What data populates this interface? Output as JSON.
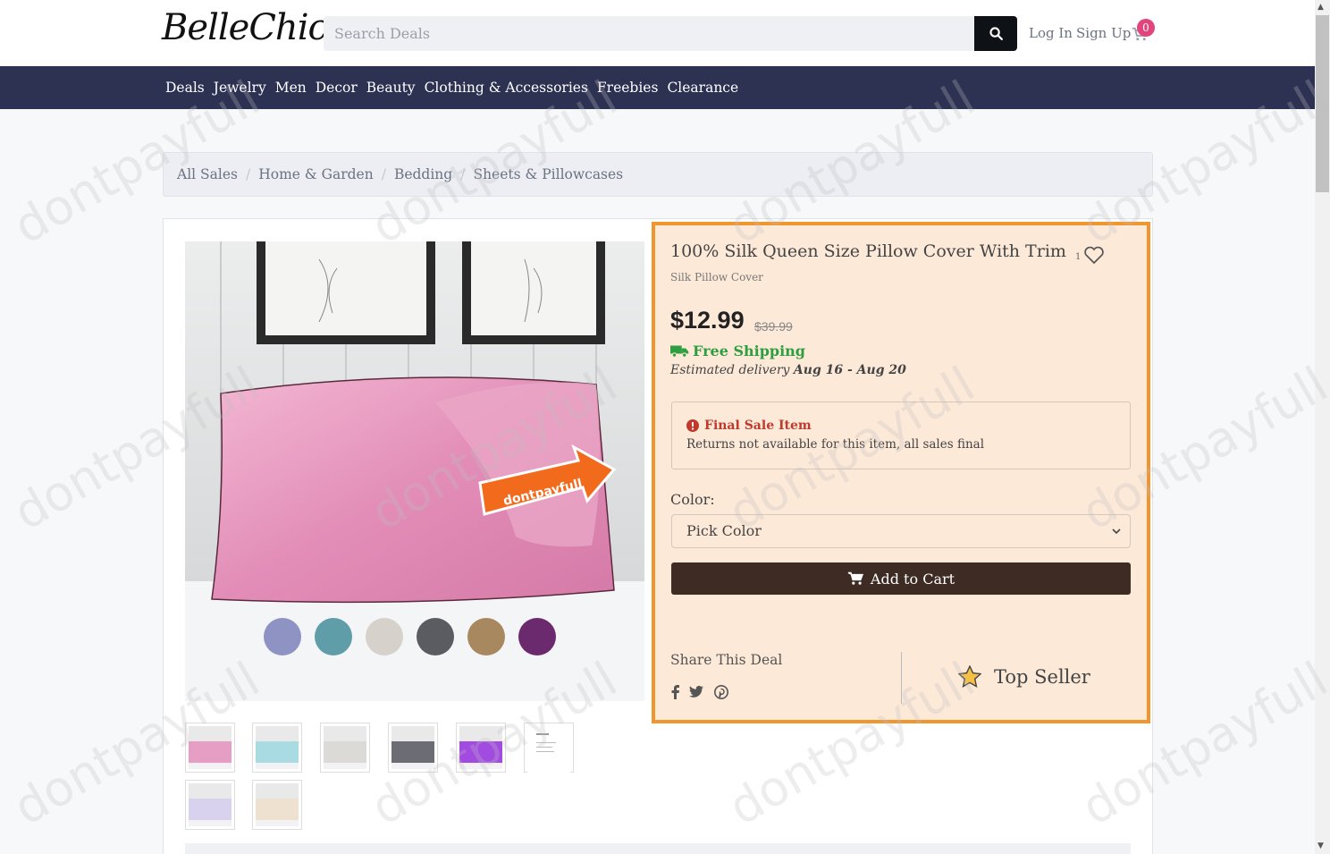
{
  "header": {
    "logo": "BelleChic",
    "search_placeholder": "Search Deals",
    "login": "Log In",
    "signup": "Sign Up",
    "cart_count": "0"
  },
  "categories": [
    "Deals",
    "Jewelry",
    "Men",
    "Decor",
    "Beauty",
    "Clothing & Accessories",
    "Freebies",
    "Clearance"
  ],
  "breadcrumb": [
    "All Sales",
    "Home & Garden",
    "Bedding",
    "Sheets & Pillowcases"
  ],
  "product": {
    "title": "100% Silk Queen Size Pillow Cover With Trim",
    "subtitle": "Silk Pillow Cover",
    "likes": "1",
    "price": "$12.99",
    "old_price": "$39.99",
    "shipping": "Free Shipping",
    "delivery_prefix": "Estimated delivery",
    "delivery_range": "Aug 16 - Aug 20",
    "final_sale_title": "Final Sale Item",
    "final_sale_text": "Returns not available for this item, all sales final",
    "color_label": "Color:",
    "color_selected": "Pick Color",
    "add_to_cart": "Add to Cart",
    "share_label": "Share This Deal",
    "top_seller": "Top Seller",
    "image_badge": "dontpayfull"
  },
  "swatch_colors": [
    "#8f93c4",
    "#5f9ea8",
    "#d6d1ca",
    "#5b5c62",
    "#a8895f",
    "#6b2a6e"
  ],
  "thumb_colors": [
    "#e69ec5",
    "#a9dbe3",
    "#dcdad7",
    "#6c6d74",
    "#a24be0",
    "#ffffff",
    "#d8d2ef",
    "#eee1cf"
  ],
  "watermark": "dontpayfull",
  "colors": {
    "accent_orange": "#f0962f",
    "nav_bg": "#2d3152",
    "cart_badge": "#e0457b",
    "shipping_green": "#2e9e40",
    "final_red": "#c0392b",
    "cart_btn": "#3e2c24"
  }
}
